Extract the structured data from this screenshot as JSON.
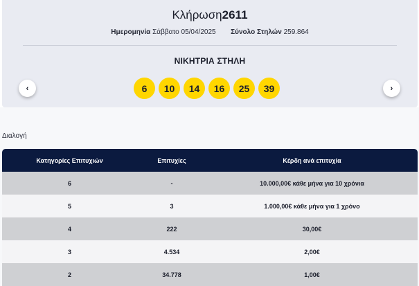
{
  "draw": {
    "title_prefix": "Κλήρωση",
    "number": "2611",
    "date_label": "Ημερομηνία",
    "date_value": "Σάββατο 05/04/2025",
    "columns_label": "Σύνολο Στηλών",
    "columns_value": "259.864"
  },
  "winning": {
    "title": "ΝΙΚΗΤΡΙΑ ΣΤΗΛΗ",
    "balls": [
      "6",
      "10",
      "14",
      "16",
      "25",
      "39"
    ],
    "ball_color": "#ffd600"
  },
  "nav": {
    "prev_icon": "‹",
    "next_icon": "›"
  },
  "section_label": "Διαλογή",
  "table": {
    "headers": [
      "Κατηγορίες Επιτυχιών",
      "Επιτυχίες",
      "Κέρδη ανά επιτυχία"
    ],
    "header_color": "#0b1a3f",
    "rows": [
      [
        "6",
        "-",
        "10.000,00€ κάθε μήνα για 10 χρόνια"
      ],
      [
        "5",
        "3",
        "1.000,00€ κάθε μήνα για 1 χρόνο"
      ],
      [
        "4",
        "222",
        "30,00€"
      ],
      [
        "3",
        "4.534",
        "2,00€"
      ],
      [
        "2",
        "34.778",
        "1,00€"
      ]
    ]
  }
}
